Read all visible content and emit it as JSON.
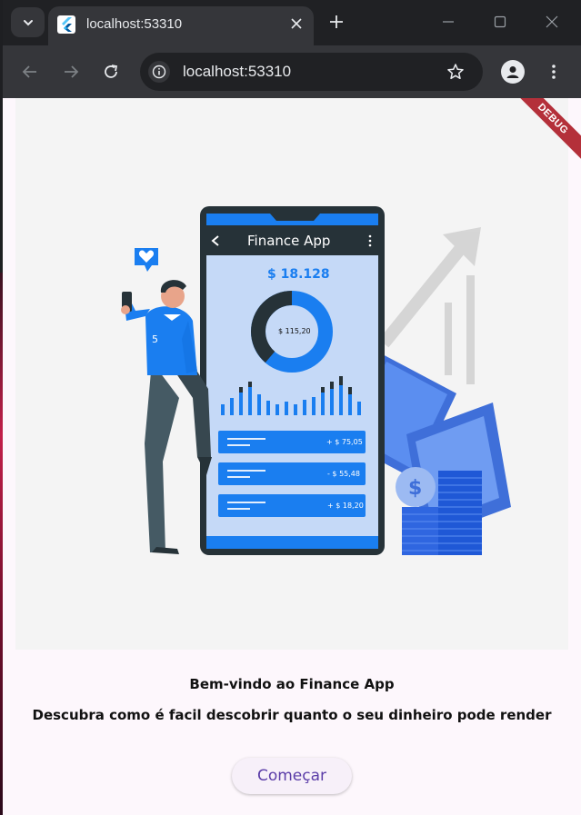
{
  "browser": {
    "tab_title": "localhost:53310",
    "url": "localhost:53310"
  },
  "app": {
    "debug_label": "DEBUG",
    "welcome_title": "Bem-vindo ao Finance App",
    "welcome_subtitle": "Descubra como é facil descobrir quanto o seu dinheiro pode render",
    "start_button_label": "Começar"
  },
  "illustration": {
    "phone_app_title": "Finance App",
    "balance": "$ 18.128",
    "donut_center": "$ 115,20",
    "transactions": [
      "+ $ 75,05",
      "- $ 55,48",
      "+ $ 18,20"
    ],
    "shirt_number": "5",
    "colors": {
      "accent_blue": "#1a7ef0",
      "phone_dark": "#263238",
      "screen_bg": "#c5d9f7"
    }
  }
}
